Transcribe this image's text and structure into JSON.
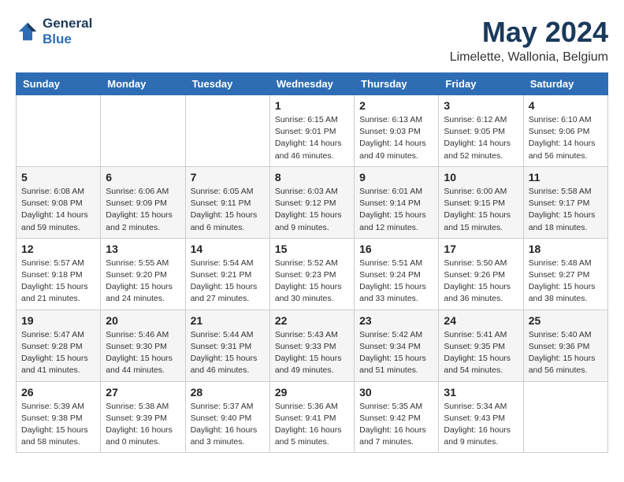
{
  "header": {
    "logo_line1": "General",
    "logo_line2": "Blue",
    "month": "May 2024",
    "location": "Limelette, Wallonia, Belgium"
  },
  "weekdays": [
    "Sunday",
    "Monday",
    "Tuesday",
    "Wednesday",
    "Thursday",
    "Friday",
    "Saturday"
  ],
  "weeks": [
    [
      {
        "day": "",
        "info": ""
      },
      {
        "day": "",
        "info": ""
      },
      {
        "day": "",
        "info": ""
      },
      {
        "day": "1",
        "info": "Sunrise: 6:15 AM\nSunset: 9:01 PM\nDaylight: 14 hours\nand 46 minutes."
      },
      {
        "day": "2",
        "info": "Sunrise: 6:13 AM\nSunset: 9:03 PM\nDaylight: 14 hours\nand 49 minutes."
      },
      {
        "day": "3",
        "info": "Sunrise: 6:12 AM\nSunset: 9:05 PM\nDaylight: 14 hours\nand 52 minutes."
      },
      {
        "day": "4",
        "info": "Sunrise: 6:10 AM\nSunset: 9:06 PM\nDaylight: 14 hours\nand 56 minutes."
      }
    ],
    [
      {
        "day": "5",
        "info": "Sunrise: 6:08 AM\nSunset: 9:08 PM\nDaylight: 14 hours\nand 59 minutes."
      },
      {
        "day": "6",
        "info": "Sunrise: 6:06 AM\nSunset: 9:09 PM\nDaylight: 15 hours\nand 2 minutes."
      },
      {
        "day": "7",
        "info": "Sunrise: 6:05 AM\nSunset: 9:11 PM\nDaylight: 15 hours\nand 6 minutes."
      },
      {
        "day": "8",
        "info": "Sunrise: 6:03 AM\nSunset: 9:12 PM\nDaylight: 15 hours\nand 9 minutes."
      },
      {
        "day": "9",
        "info": "Sunrise: 6:01 AM\nSunset: 9:14 PM\nDaylight: 15 hours\nand 12 minutes."
      },
      {
        "day": "10",
        "info": "Sunrise: 6:00 AM\nSunset: 9:15 PM\nDaylight: 15 hours\nand 15 minutes."
      },
      {
        "day": "11",
        "info": "Sunrise: 5:58 AM\nSunset: 9:17 PM\nDaylight: 15 hours\nand 18 minutes."
      }
    ],
    [
      {
        "day": "12",
        "info": "Sunrise: 5:57 AM\nSunset: 9:18 PM\nDaylight: 15 hours\nand 21 minutes."
      },
      {
        "day": "13",
        "info": "Sunrise: 5:55 AM\nSunset: 9:20 PM\nDaylight: 15 hours\nand 24 minutes."
      },
      {
        "day": "14",
        "info": "Sunrise: 5:54 AM\nSunset: 9:21 PM\nDaylight: 15 hours\nand 27 minutes."
      },
      {
        "day": "15",
        "info": "Sunrise: 5:52 AM\nSunset: 9:23 PM\nDaylight: 15 hours\nand 30 minutes."
      },
      {
        "day": "16",
        "info": "Sunrise: 5:51 AM\nSunset: 9:24 PM\nDaylight: 15 hours\nand 33 minutes."
      },
      {
        "day": "17",
        "info": "Sunrise: 5:50 AM\nSunset: 9:26 PM\nDaylight: 15 hours\nand 36 minutes."
      },
      {
        "day": "18",
        "info": "Sunrise: 5:48 AM\nSunset: 9:27 PM\nDaylight: 15 hours\nand 38 minutes."
      }
    ],
    [
      {
        "day": "19",
        "info": "Sunrise: 5:47 AM\nSunset: 9:28 PM\nDaylight: 15 hours\nand 41 minutes."
      },
      {
        "day": "20",
        "info": "Sunrise: 5:46 AM\nSunset: 9:30 PM\nDaylight: 15 hours\nand 44 minutes."
      },
      {
        "day": "21",
        "info": "Sunrise: 5:44 AM\nSunset: 9:31 PM\nDaylight: 15 hours\nand 46 minutes."
      },
      {
        "day": "22",
        "info": "Sunrise: 5:43 AM\nSunset: 9:33 PM\nDaylight: 15 hours\nand 49 minutes."
      },
      {
        "day": "23",
        "info": "Sunrise: 5:42 AM\nSunset: 9:34 PM\nDaylight: 15 hours\nand 51 minutes."
      },
      {
        "day": "24",
        "info": "Sunrise: 5:41 AM\nSunset: 9:35 PM\nDaylight: 15 hours\nand 54 minutes."
      },
      {
        "day": "25",
        "info": "Sunrise: 5:40 AM\nSunset: 9:36 PM\nDaylight: 15 hours\nand 56 minutes."
      }
    ],
    [
      {
        "day": "26",
        "info": "Sunrise: 5:39 AM\nSunset: 9:38 PM\nDaylight: 15 hours\nand 58 minutes."
      },
      {
        "day": "27",
        "info": "Sunrise: 5:38 AM\nSunset: 9:39 PM\nDaylight: 16 hours\nand 0 minutes."
      },
      {
        "day": "28",
        "info": "Sunrise: 5:37 AM\nSunset: 9:40 PM\nDaylight: 16 hours\nand 3 minutes."
      },
      {
        "day": "29",
        "info": "Sunrise: 5:36 AM\nSunset: 9:41 PM\nDaylight: 16 hours\nand 5 minutes."
      },
      {
        "day": "30",
        "info": "Sunrise: 5:35 AM\nSunset: 9:42 PM\nDaylight: 16 hours\nand 7 minutes."
      },
      {
        "day": "31",
        "info": "Sunrise: 5:34 AM\nSunset: 9:43 PM\nDaylight: 16 hours\nand 9 minutes."
      },
      {
        "day": "",
        "info": ""
      }
    ]
  ]
}
